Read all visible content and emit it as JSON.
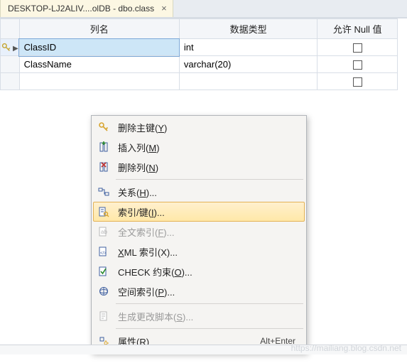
{
  "tab": {
    "title": "DESKTOP-LJ2ALIV....olDB - dbo.class",
    "close_glyph": "×"
  },
  "grid": {
    "headers": {
      "name": "列名",
      "type": "数据类型",
      "null": "允许 Null 值"
    },
    "rows": [
      {
        "name": "ClassID",
        "type": "int",
        "pk": true,
        "selected": true
      },
      {
        "name": "ClassName",
        "type": "varchar(20)",
        "pk": false,
        "selected": false
      },
      {
        "name": "",
        "type": "",
        "pk": false,
        "selected": false
      }
    ]
  },
  "context_menu": {
    "items": [
      {
        "id": "remove-pk",
        "label": "删除主键(Y)",
        "hotkey": "Y",
        "icon": "key",
        "enabled": true
      },
      {
        "id": "insert-col",
        "label": "插入列(M)",
        "hotkey": "M",
        "icon": "insert-col",
        "enabled": true
      },
      {
        "id": "delete-col",
        "label": "删除列(N)",
        "hotkey": "N",
        "icon": "delete-col",
        "enabled": true
      },
      {
        "sep": true
      },
      {
        "id": "relations",
        "label": "关系(H)...",
        "hotkey": "H",
        "icon": "relation",
        "enabled": true
      },
      {
        "id": "indexes",
        "label": "索引/键(I)...",
        "hotkey": "I",
        "icon": "index",
        "enabled": true,
        "highlight": true
      },
      {
        "id": "fulltext",
        "label": "全文索引(F)...",
        "hotkey": "F",
        "icon": "fulltext",
        "enabled": false
      },
      {
        "id": "xmlindex",
        "label": "XML 索引(X)...",
        "hotkey": "X",
        "icon": "xml",
        "enabled": true
      },
      {
        "id": "check",
        "label": "CHECK 约束(O)...",
        "hotkey": "O",
        "icon": "check",
        "enabled": true
      },
      {
        "id": "spatial",
        "label": "空间索引(P)...",
        "hotkey": "P",
        "icon": "spatial",
        "enabled": true
      },
      {
        "sep": true
      },
      {
        "id": "genscript",
        "label": "生成更改脚本(S)...",
        "hotkey": "S",
        "icon": "script",
        "enabled": false
      },
      {
        "sep": true
      },
      {
        "id": "properties",
        "label": "属性(R)",
        "hotkey": "R",
        "icon": "props",
        "enabled": true,
        "shortcut": "Alt+Enter"
      }
    ]
  },
  "watermark": "https://mailiang.blog.csdn.net"
}
